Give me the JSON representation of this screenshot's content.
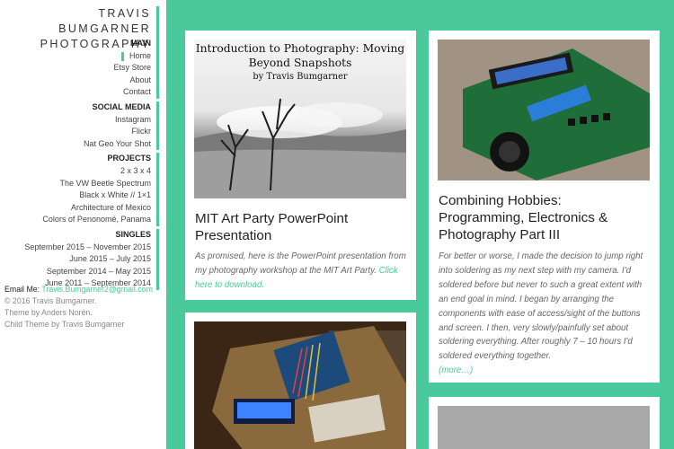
{
  "site": {
    "title": "TRAVIS BUMGARNER PHOTOGRAPHY",
    "accent": "#4ac99d"
  },
  "sidebar": {
    "groups": [
      {
        "heading": "MAIN",
        "items": [
          "Home",
          "Etsy Store",
          "About",
          "Contact"
        ]
      },
      {
        "heading": "SOCIAL MEDIA",
        "items": [
          "Instagram",
          "Flickr",
          "Nat Geo Your Shot"
        ]
      },
      {
        "heading": "PROJECTS",
        "items": [
          "2 x 3 x 4",
          "The VW Beetle Spectrum",
          "Black x White // 1×1",
          "Architecture of Mexico",
          "Colors of Penonomé, Panama"
        ]
      },
      {
        "heading": "SINGLES",
        "items": [
          "September 2015 – November 2015",
          "June 2015 – July 2015",
          "September 2014 – May 2015",
          "June 2011 – September 2014"
        ]
      }
    ],
    "active_item": "Home"
  },
  "footer": {
    "email_label": "Email Me:",
    "email": "Travis.Bumgarner2@gmail.com",
    "copyright": "© 2016 Travis Bumgarner.",
    "theme": "Theme by Anders Norén.",
    "child_theme": "Child Theme by Travis Bumgarner"
  },
  "posts": [
    {
      "thumb_title": "Introduction to Photography: Moving Beyond Snapshots",
      "thumb_author": "by Travis Bumgarner",
      "title": "MIT Art Party PowerPoint Presentation",
      "excerpt": "As promised, here is the PowerPoint presentation from my photography workshop at the MIT Art Party.",
      "link": "Click here to download."
    },
    {
      "title": "Combining Hobbies: Programming, Electronics & Photography Part III",
      "excerpt": "For better or worse, I made the decision to jump right into soldering as my next step with my camera. I'd soldered before but never to such a great extent with an end goal in mind. I began by arranging the components with ease of access/sight of the buttons and screen. I then, very slowly/painfully set about soldering everything. After roughly 7 – 10 hours I'd soldered everything together.",
      "more": "(more…)"
    }
  ]
}
